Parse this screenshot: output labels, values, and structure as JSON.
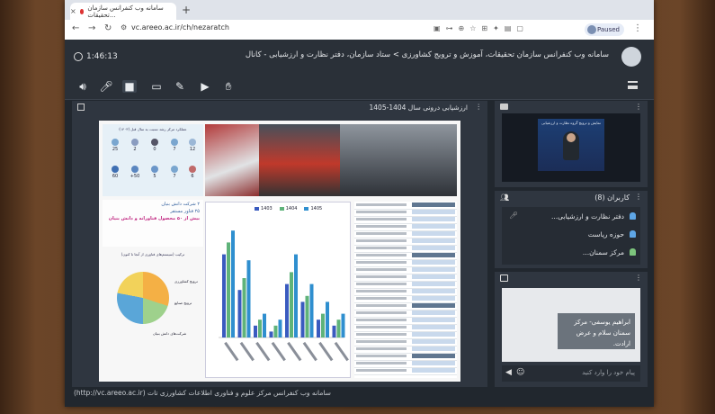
{
  "browser": {
    "tab_title": "سامانه وب کنفرانس سازمان تحقیقات...",
    "tab_close": "×",
    "new_tab": "+",
    "url": "vc.areeo.ac.ir/ch/nezaratch",
    "profile_status": "Paused",
    "back": "←",
    "forward": "→",
    "reload": "↻",
    "menu": "⋮"
  },
  "app": {
    "timer": "1:46:13",
    "title": "سامانه وب کنفرانس سازمان تحقیقات، آموزش و ترویج کشاورزی > ستاد سازمان، دفتر نظارت و ارزشیابی - کانال",
    "footer": "(http://vc.areeo.ac.ir) سامانه وب کنفرانس مرکز علوم و فناوری اطلاعات کشاورزی تات"
  },
  "toolbar": {
    "icons": [
      "speaker-icon",
      "mic-icon",
      "camera-icon",
      "screen-share-icon",
      "pen-icon",
      "play-icon",
      "hand-icon"
    ]
  },
  "presentation": {
    "title": "ارزشیابی درونی سال 1404-1405",
    "menu": "⋮",
    "slide": {
      "info_header": "عملکرد مرکز رشد نسبت به سال قبل (۱۴۰۳)",
      "stats": [
        "25",
        "2",
        "0",
        "7",
        "12",
        "60",
        "+50",
        "5",
        "7",
        "6"
      ],
      "bullets": [
        "۲ شرکت دانش بنیان",
        "۲۵ فناور مستقر",
        "بیش از ۵۰ محصول فناورانه و دانش بنیان"
      ],
      "pie_title": "ترکیب (سیستم‌های فناوری از آنجا تا کنون)",
      "pie_labels": [
        "ترویج کشاورزی",
        "ترویج صنایع",
        "شرکت‌های دانش بنیان"
      ],
      "chart_legend": [
        "1403",
        "1404",
        "1405"
      ]
    }
  },
  "video_panel": {
    "menu": "⋮",
    "banner": "نمایش و ترویج گروه نظارت و ارزشیابی"
  },
  "users_panel": {
    "title": "کاربران (8)",
    "menu": "⋮",
    "users": [
      "دفتر نظارت و ارزشیابی...",
      "حوزه ریاست",
      "مرکز سمنان..."
    ]
  },
  "chat_panel": {
    "menu": "⋮",
    "message": "ابراهیم یوسفی- مرکز سمنان سلام و عرض ارادت.",
    "input_placeholder": "پیام خود را وارد کنید"
  },
  "chart_data": {
    "type": "bar",
    "categories": [
      "c1",
      "c2",
      "c3",
      "c4",
      "c5",
      "c6",
      "c7",
      "c8"
    ],
    "series": [
      {
        "name": "1403",
        "values": [
          14,
          8,
          2,
          1,
          9,
          6,
          3,
          2
        ]
      },
      {
        "name": "1404",
        "values": [
          16,
          10,
          3,
          2,
          11,
          7,
          4,
          3
        ]
      },
      {
        "name": "1405",
        "values": [
          18,
          13,
          4,
          3,
          14,
          9,
          6,
          4
        ]
      }
    ],
    "ylim": [
      0,
      20
    ],
    "colors": [
      "#3a5bbf",
      "#5fb37a",
      "#2f8fcf"
    ]
  }
}
